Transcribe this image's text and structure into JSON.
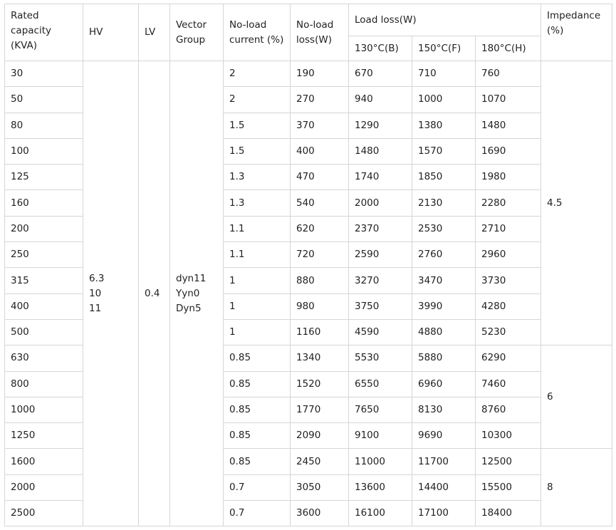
{
  "headers": {
    "rated_capacity": [
      "Rated",
      "capacity",
      "(KVA)"
    ],
    "hv": "HV",
    "lv": "LV",
    "vector_group": [
      "Vector",
      "Group"
    ],
    "no_load_current": [
      "No-load",
      "current (%)"
    ],
    "no_load_loss": [
      "No-load",
      "loss(W)"
    ],
    "load_loss": "Load loss(W)",
    "impedance": [
      "Impedance",
      "(%)"
    ],
    "temp_b": "130°C(B)",
    "temp_f": "150°C(F)",
    "temp_h": "180°C(H)"
  },
  "hv_values": [
    "6.3",
    "10",
    "11"
  ],
  "lv_value": "0.4",
  "vector_groups": [
    "dyn11",
    "Yyn0",
    "Dyn5"
  ],
  "impedance_groups": [
    "4.5",
    "6",
    "8"
  ],
  "rows": [
    {
      "capacity": "30",
      "current": "2",
      "noload": "190",
      "b": "670",
      "f": "710",
      "h": "760"
    },
    {
      "capacity": "50",
      "current": "2",
      "noload": "270",
      "b": "940",
      "f": "1000",
      "h": "1070"
    },
    {
      "capacity": "80",
      "current": "1.5",
      "noload": "370",
      "b": "1290",
      "f": "1380",
      "h": "1480"
    },
    {
      "capacity": "100",
      "current": "1.5",
      "noload": "400",
      "b": "1480",
      "f": "1570",
      "h": "1690"
    },
    {
      "capacity": "125",
      "current": "1.3",
      "noload": "470",
      "b": "1740",
      "f": "1850",
      "h": "1980"
    },
    {
      "capacity": "160",
      "current": "1.3",
      "noload": "540",
      "b": "2000",
      "f": "2130",
      "h": "2280"
    },
    {
      "capacity": "200",
      "current": "1.1",
      "noload": "620",
      "b": "2370",
      "f": "2530",
      "h": "2710"
    },
    {
      "capacity": "250",
      "current": "1.1",
      "noload": "720",
      "b": "2590",
      "f": "2760",
      "h": "2960"
    },
    {
      "capacity": "315",
      "current": "1",
      "noload": "880",
      "b": "3270",
      "f": "3470",
      "h": "3730"
    },
    {
      "capacity": "400",
      "current": "1",
      "noload": "980",
      "b": "3750",
      "f": "3990",
      "h": "4280"
    },
    {
      "capacity": "500",
      "current": "1",
      "noload": "1160",
      "b": "4590",
      "f": "4880",
      "h": "5230"
    },
    {
      "capacity": "630",
      "current": "0.85",
      "noload": "1340",
      "b": "5530",
      "f": "5880",
      "h": "6290"
    },
    {
      "capacity": "800",
      "current": "0.85",
      "noload": "1520",
      "b": "6550",
      "f": "6960",
      "h": "7460"
    },
    {
      "capacity": "1000",
      "current": "0.85",
      "noload": "1770",
      "b": "7650",
      "f": "8130",
      "h": "8760"
    },
    {
      "capacity": "1250",
      "current": "0.85",
      "noload": "2090",
      "b": "9100",
      "f": "9690",
      "h": "10300"
    },
    {
      "capacity": "1600",
      "current": "0.85",
      "noload": "2450",
      "b": "11000",
      "f": "11700",
      "h": "12500"
    },
    {
      "capacity": "2000",
      "current": "0.7",
      "noload": "3050",
      "b": "13600",
      "f": "14400",
      "h": "15500"
    },
    {
      "capacity": "2500",
      "current": "0.7",
      "noload": "3600",
      "b": "16100",
      "f": "17100",
      "h": "18400"
    }
  ]
}
